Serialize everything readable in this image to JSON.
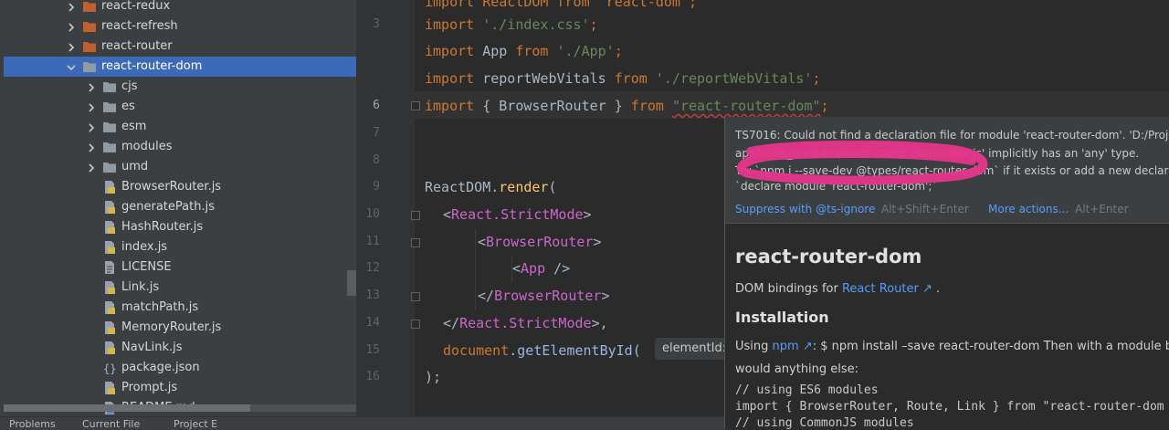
{
  "tree": {
    "items": [
      {
        "label": "react-redux",
        "kind": "folder-orange",
        "expanded": false
      },
      {
        "label": "react-refresh",
        "kind": "folder-orange",
        "expanded": false
      },
      {
        "label": "react-router",
        "kind": "folder-orange",
        "expanded": false
      },
      {
        "label": "react-router-dom",
        "kind": "folder",
        "expanded": true,
        "selected": true
      },
      {
        "label": "cjs",
        "kind": "folder",
        "expanded": false
      },
      {
        "label": "es",
        "kind": "folder",
        "expanded": false
      },
      {
        "label": "esm",
        "kind": "folder",
        "expanded": false
      },
      {
        "label": "modules",
        "kind": "folder",
        "expanded": false
      },
      {
        "label": "umd",
        "kind": "folder",
        "expanded": false
      },
      {
        "label": "BrowserRouter.js",
        "kind": "js-file"
      },
      {
        "label": "generatePath.js",
        "kind": "js-file"
      },
      {
        "label": "HashRouter.js",
        "kind": "js-file"
      },
      {
        "label": "index.js",
        "kind": "js-file"
      },
      {
        "label": "LICENSE",
        "kind": "text-file"
      },
      {
        "label": "Link.js",
        "kind": "js-file"
      },
      {
        "label": "matchPath.js",
        "kind": "js-file"
      },
      {
        "label": "MemoryRouter.js",
        "kind": "js-file"
      },
      {
        "label": "NavLink.js",
        "kind": "js-file"
      },
      {
        "label": "package.json",
        "kind": "json-file"
      },
      {
        "label": "Prompt.js",
        "kind": "js-file"
      },
      {
        "label": "README.md",
        "kind": "md-file"
      }
    ]
  },
  "status": {
    "left": "Problems",
    "mid": "Current File",
    "right": "Project E"
  },
  "editor": {
    "line_numbers": [
      "3",
      "6",
      "7",
      "8",
      "9",
      "10",
      "11",
      "12",
      "13",
      "14",
      "15",
      "16"
    ],
    "top_partial": "import ReactDOM from 'react-dom';",
    "line3": {
      "kw": "import",
      "str": "'./index.css'",
      "end": ";"
    },
    "line4": {
      "kw": "import",
      "name": "App",
      "from": "from",
      "str": "'./App'",
      "end": ";"
    },
    "line5": {
      "kw": "import",
      "name": "reportWebVitals",
      "from": "from",
      "str": "'./reportWebVitals'",
      "end": ";"
    },
    "line6": {
      "kw": "import",
      "mid": "{ BrowserRouter }",
      "from": "from",
      "str": "\"react-router-dom\"",
      "end": ";"
    },
    "line9": {
      "obj": "ReactDOM.",
      "fn": "render",
      "end": "("
    },
    "line10": {
      "open": "<",
      "tag": "React.StrictMode",
      "close": ">"
    },
    "line11": {
      "open": "<",
      "tag": "BrowserRouter",
      "close": ">"
    },
    "line12": {
      "open": "<",
      "tag": "App",
      "close": " />"
    },
    "line13": {
      "open": "</",
      "tag": "BrowserRouter",
      "close": ">"
    },
    "line14": {
      "open": "</",
      "tag": "React.StrictMode",
      "close": ">,"
    },
    "line15": {
      "obj": "document",
      "dot": ".",
      "fn": "getElementById",
      "paren": "("
    },
    "line16": {
      "text": ");"
    },
    "param_hint": "elementId:"
  },
  "popup": {
    "err1": "TS7016: Could not find a declaration file for module 'react-router-dom'. 'D:/Projec",
    "err2": "app/node_modules/react-router-dom/index.js' implicitly has an 'any' type.",
    "err3": "Try `npm i --save-dev @types/react-router-dom` if it exists or add a new declara",
    "err4": "`declare module 'react-router-dom';`",
    "action1": "Suppress with @ts-ignore",
    "action1_shortcut": "Alt+Shift+Enter",
    "action2": "More actions...",
    "action2_shortcut": "Alt+Enter",
    "doc_title": "react-router-dom",
    "doc_desc_prefix": "DOM bindings for",
    "doc_desc_link": "React Router",
    "doc_desc_suffix": " .",
    "doc_h2": "Installation",
    "install_prefix": "Using",
    "install_link": "npm",
    "install_rest": ": $ npm install –save react-router-dom Then with a module bund",
    "install_line2": "would anything else:",
    "code1": "// using ES6 modules",
    "code2": "import { BrowserRouter, Route, Link } from \"react-router-dom",
    "code3": "// using CommonJS modules"
  },
  "colors": {
    "selection": "#3c6ab8",
    "keyword": "#cc7832",
    "string": "#6a8759",
    "tag": "#e8bf6a",
    "link": "#589df6",
    "marker": "#e6358b"
  }
}
